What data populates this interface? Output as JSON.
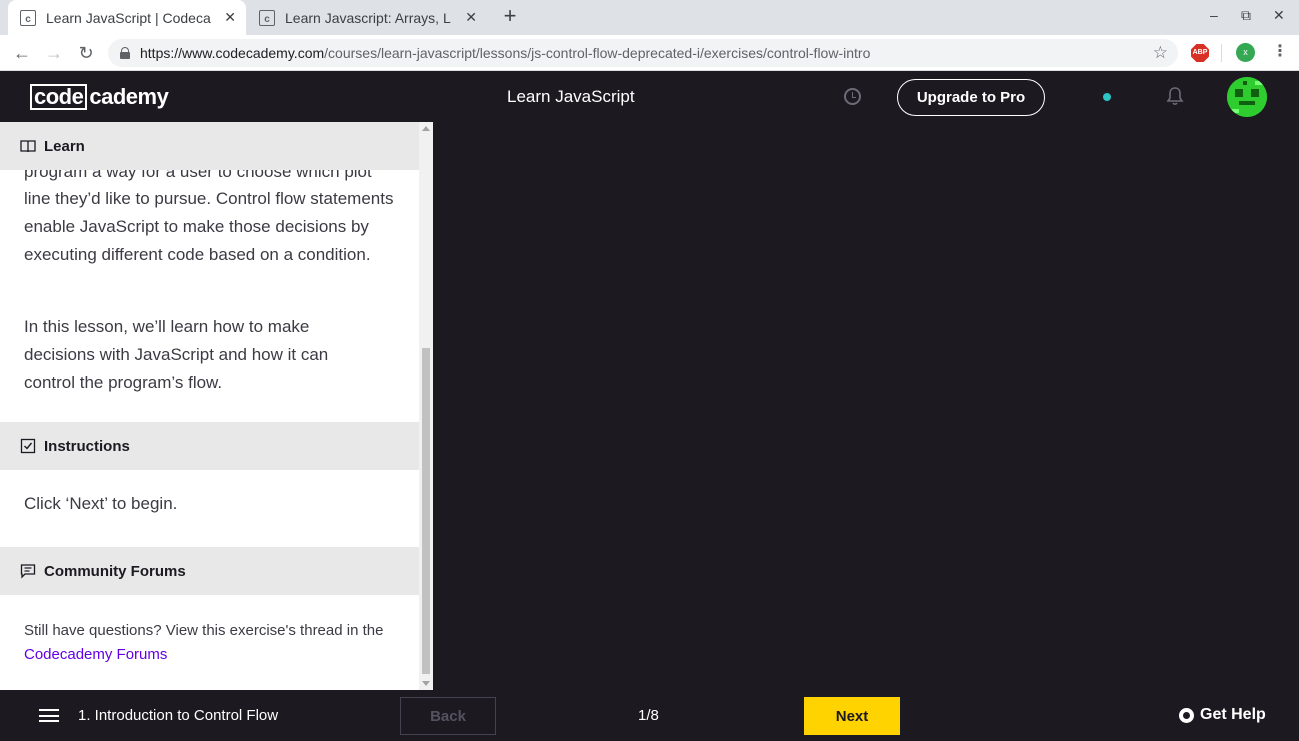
{
  "browser": {
    "tabs": [
      {
        "title": "Learn JavaScript | Codeca",
        "active": true
      },
      {
        "title": "Learn Javascript: Arrays, L",
        "active": false
      }
    ],
    "url_host": "https://www.codecademy.com",
    "url_path": "/courses/learn-javascript/lessons/js-control-flow-deprecated-i/exercises/control-flow-intro",
    "extension_abp": "ABP",
    "profile_initial": "x"
  },
  "header": {
    "logo_boxed": "code",
    "logo_rest": "cademy",
    "course_title": "Learn JavaScript",
    "upgrade_label": "Upgrade to Pro"
  },
  "panel": {
    "learn_heading": "Learn",
    "partial_line": "program a way for a user to choose which plot",
    "paragraph1_rest": "line they’d like to pursue. Control flow statements enable JavaScript to make those decisions by executing different code based on a condition.",
    "paragraph2": "In this lesson, we’ll learn how to make decisions with JavaScript and how it can control the program’s flow.",
    "instructions_heading": "Instructions",
    "instructions_text": "Click ‘Next’ to begin.",
    "forums_heading": "Community Forums",
    "forums_text": "Still have questions? View this exercise's thread in the",
    "forums_link": "Codecademy Forums"
  },
  "bottom": {
    "lesson_name": "1. Introduction to Control Flow",
    "back_label": "Back",
    "progress": "1/8",
    "next_label": "Next",
    "help_label": "Get Help"
  },
  "colors": {
    "brand_dark": "#1c1921",
    "next_yellow": "#ffd300",
    "link_purple": "#6400e4",
    "status_dot": "#2ec4c4"
  }
}
